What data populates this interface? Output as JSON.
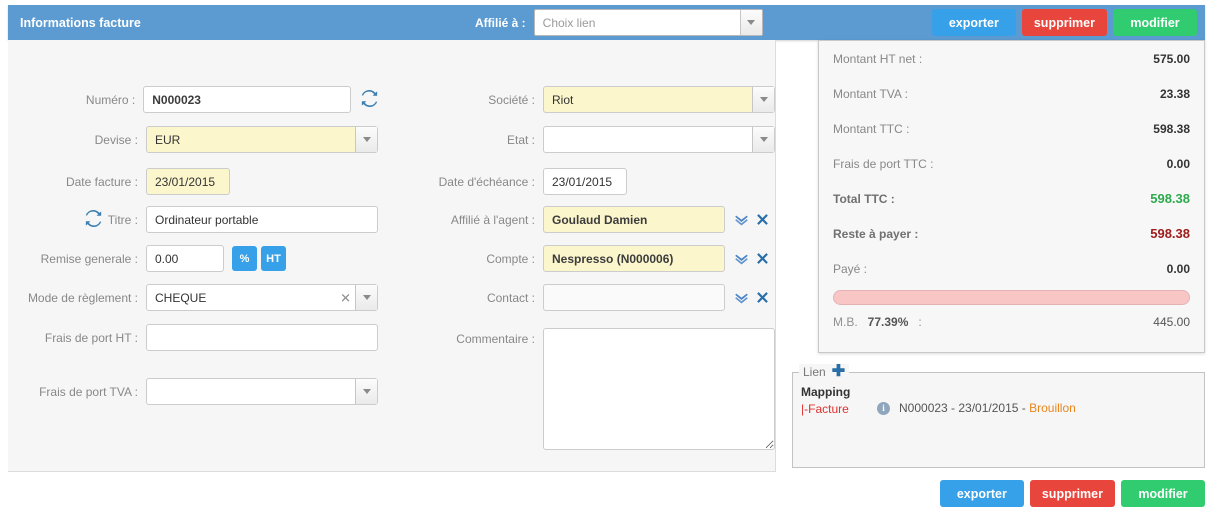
{
  "header": {
    "title": "Informations facture",
    "affilie_label": "Affilié à :",
    "affilie_placeholder": "Choix lien",
    "affilie_value": "",
    "buttons": {
      "export": "exporter",
      "delete": "supprimer",
      "modify": "modifier"
    }
  },
  "document": {
    "status_title": "BROUILLON"
  },
  "form": {
    "left": {
      "numero_label": "Numéro :",
      "numero_value": "N000023",
      "devise_label": "Devise :",
      "devise_value": "EUR",
      "date_facture_label": "Date facture :",
      "date_facture_value": "23/01/2015",
      "titre_label": "Titre :",
      "titre_value": "Ordinateur portable",
      "remise_label": "Remise generale :",
      "remise_value": "0.00",
      "remise_pct_button": "%",
      "remise_ht_button": "HT",
      "mode_reglement_label": "Mode de règlement :",
      "mode_reglement_value": "CHEQUE",
      "frais_port_ht_label": "Frais de port HT :",
      "frais_port_ht_value": "",
      "frais_port_tva_label": "Frais de port TVA :",
      "frais_port_tva_value": ""
    },
    "right": {
      "societe_label": "Société :",
      "societe_value": "Riot",
      "etat_label": "Etat :",
      "etat_value": "",
      "date_echeance_label": "Date d'échéance :",
      "date_echeance_value": "23/01/2015",
      "affilie_agent_label": "Affilié à l'agent :",
      "affilie_agent_value": "Goulaud Damien",
      "compte_label": "Compte :",
      "compte_value": "Nespresso (N000006)",
      "contact_label": "Contact :",
      "contact_value": "",
      "commentaire_label": "Commentaire :",
      "commentaire_value": ""
    }
  },
  "summary": {
    "rows": [
      {
        "label": "Montant HT net :",
        "value": "575.00"
      },
      {
        "label": "Montant TVA :",
        "value": "23.38"
      },
      {
        "label": "Montant TTC :",
        "value": "598.38"
      },
      {
        "label": "Frais de port TTC :",
        "value": "0.00"
      },
      {
        "label": "Total TTC :",
        "value": "598.38"
      },
      {
        "label": "Reste à payer :",
        "value": "598.38"
      },
      {
        "label": "Payé :",
        "value": "0.00"
      }
    ],
    "progress_percent": 100,
    "mb_label": "M.B.",
    "mb_percent": "77.39%",
    "mb_colon": ":",
    "mb_value": "445.00"
  },
  "lien": {
    "legend": "Lien",
    "mapping_title": "Mapping",
    "mapping_sub": "|-Facture",
    "entry_text": "N000023 - 23/01/2015 - ",
    "entry_status": "Brouillon"
  },
  "footer": {
    "buttons": {
      "export": "exporter",
      "delete": "supprimer",
      "modify": "modifier"
    }
  },
  "colors": {
    "header_blue": "#5b9bd1",
    "export_blue": "#36a0e8",
    "delete_red": "#e8453c",
    "modify_green": "#31cc70",
    "status_orange": "#e8861e",
    "total_green": "#2eaa4e",
    "reste_red": "#9e1b1b",
    "highlight_yellow": "#fcf6cd",
    "progress_pink": "#f9c6c6"
  }
}
